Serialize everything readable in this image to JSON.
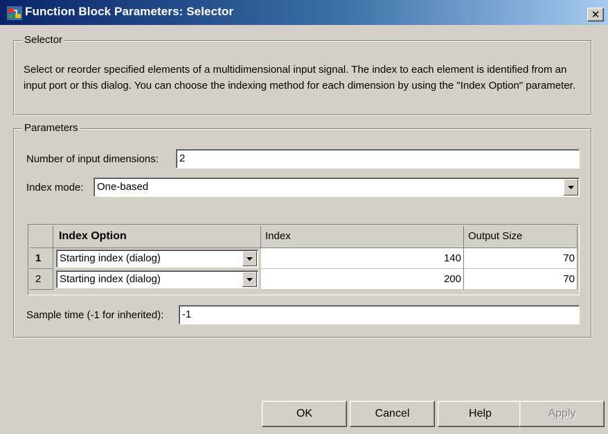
{
  "window": {
    "title": "Function Block Parameters: Selector",
    "close_glyph": "✕",
    "app_icon": "simulink-block-icon"
  },
  "selector_group": {
    "legend": "Selector",
    "description": "Select or reorder specified elements of a multidimensional input signal. The index to each element is identified from an input port or this dialog. You can choose the indexing method for each dimension by using the \"Index Option\" parameter."
  },
  "parameters_group": {
    "legend": "Parameters",
    "num_dims_label": "Number of input dimensions:",
    "num_dims_value": "2",
    "index_mode_label": "Index mode:",
    "index_mode_value": "One-based",
    "table": {
      "headers": [
        "Index Option",
        "Index",
        "Output Size"
      ],
      "rows": [
        {
          "num": "1",
          "option": "Starting index (dialog)",
          "index": "140",
          "output_size": "70"
        },
        {
          "num": "2",
          "option": "Starting index (dialog)",
          "index": "200",
          "output_size": "70"
        }
      ]
    },
    "sample_time_label": "Sample time (-1 for inherited):",
    "sample_time_value": "-1"
  },
  "buttons": {
    "ok": "OK",
    "cancel": "Cancel",
    "help": "Help",
    "apply": "Apply"
  },
  "colors": {
    "face": "#d4d0c8",
    "title_gradient_start": "#0a246a",
    "title_gradient_end": "#a6caf0"
  }
}
